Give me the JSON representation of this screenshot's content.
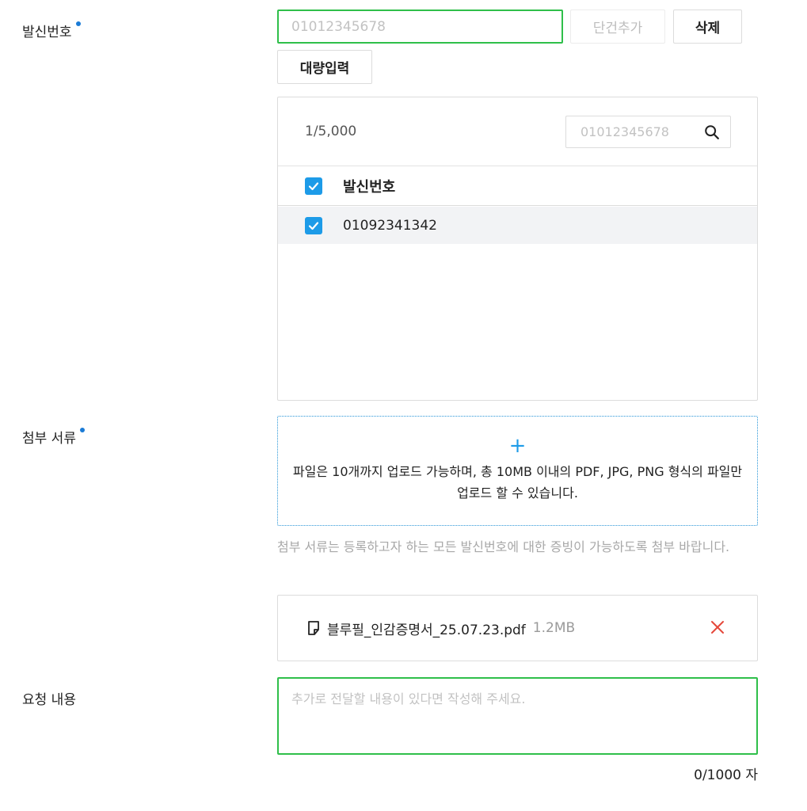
{
  "sender_number": {
    "label": "발신번호",
    "input_placeholder": "01012345678",
    "add_button": "단건추가",
    "delete_button": "삭제",
    "bulk_button": "대량입력",
    "list": {
      "count_text": "1/5,000",
      "search_placeholder": "01012345678",
      "header": "발신번호",
      "rows": [
        "01092341342"
      ]
    }
  },
  "attachment": {
    "label": "첨부 서류",
    "upload_plus": "+",
    "upload_text": "파일은 10개까지 업로드 가능하며, 총 10MB 이내의 PDF, JPG, PNG 형식의 파일만 업로드 할 수 있습니다.",
    "hint": "첨부 서류는 등록하고자 하는 모든 발신번호에 대한 증빙이 가능하도록 첨부 바랍니다.",
    "file": {
      "name": "블루필_인감증명서_25.07.23.pdf",
      "size": "1.2MB"
    }
  },
  "request": {
    "label": "요청 내용",
    "placeholder": "추가로 전달할 내용이 있다면 작성해 주세요.",
    "char_count": "0/1000 자"
  },
  "colors": {
    "focus_green": "#2fbf4a",
    "accent_blue": "#1d9be8",
    "required_dot": "#1a7bd6",
    "remove_red": "#e5483b"
  },
  "icons": {
    "search": "search-icon",
    "file": "file-icon",
    "remove": "close-icon",
    "check": "check-icon",
    "plus": "plus-icon"
  }
}
